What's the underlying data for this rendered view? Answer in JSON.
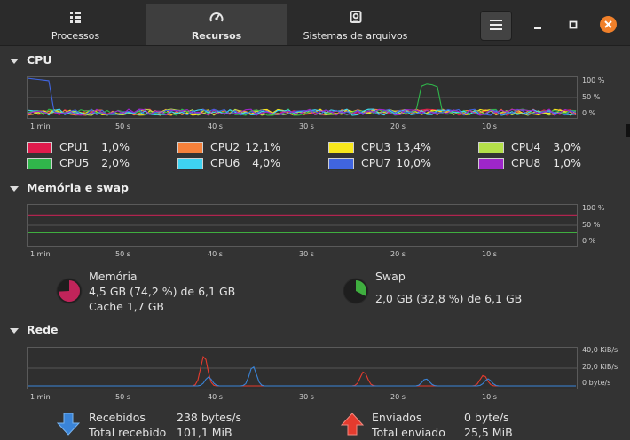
{
  "tabs": [
    {
      "label": "Processos",
      "icon": "list-icon"
    },
    {
      "label": "Recursos",
      "icon": "gauge-icon"
    },
    {
      "label": "Sistemas de arquivos",
      "icon": "disk-icon"
    }
  ],
  "sections": {
    "cpu": "CPU",
    "memory": "Memória e swap",
    "network": "Rede"
  },
  "axis": {
    "cpu_y": [
      "100 %",
      "50 %",
      "0 %"
    ],
    "mem_y": [
      "100 %",
      "50 %",
      "0 %"
    ],
    "net_y": [
      "40,0 KiB/s",
      "20,0 KiB/s",
      "0 byte/s"
    ],
    "x": [
      "1 min",
      "50 s",
      "40 s",
      "30 s",
      "20 s",
      "10 s"
    ]
  },
  "cpus": [
    {
      "name": "CPU1",
      "value": "1,0%",
      "color": "#e01b4c"
    },
    {
      "name": "CPU2",
      "value": "12,1%",
      "color": "#f6813b"
    },
    {
      "name": "CPU3",
      "value": "13,4%",
      "color": "#f8e71c"
    },
    {
      "name": "CPU4",
      "value": "3,0%",
      "color": "#b5e04a"
    },
    {
      "name": "CPU5",
      "value": "2,0%",
      "color": "#30b64b"
    },
    {
      "name": "CPU6",
      "value": "4,0%",
      "color": "#3ed3f2"
    },
    {
      "name": "CPU7",
      "value": "10,0%",
      "color": "#4065e0"
    },
    {
      "name": "CPU8",
      "value": "1,0%",
      "color": "#9e26c9"
    }
  ],
  "memory": {
    "title": "Memória",
    "usage": "4,5 GB (74,2 %) de 6,1 GB",
    "cache": "Cache 1,7 GB",
    "fraction": 0.742,
    "color": "#c0245a"
  },
  "swap": {
    "title": "Swap",
    "usage": "2,0 GB (32,8 %) de 6,1 GB",
    "fraction": 0.328,
    "color": "#3fae3f"
  },
  "network": {
    "received_label": "Recebidos",
    "received_value": "238 bytes/s",
    "received_total_label": "Total recebido",
    "received_total_value": "101,1 MiB",
    "sent_label": "Enviados",
    "sent_value": "0 byte/s",
    "sent_total_label": "Total enviado",
    "sent_total_value": "25,5 MiB",
    "received_color": "#3a84d8",
    "sent_color": "#e53b2e"
  }
}
